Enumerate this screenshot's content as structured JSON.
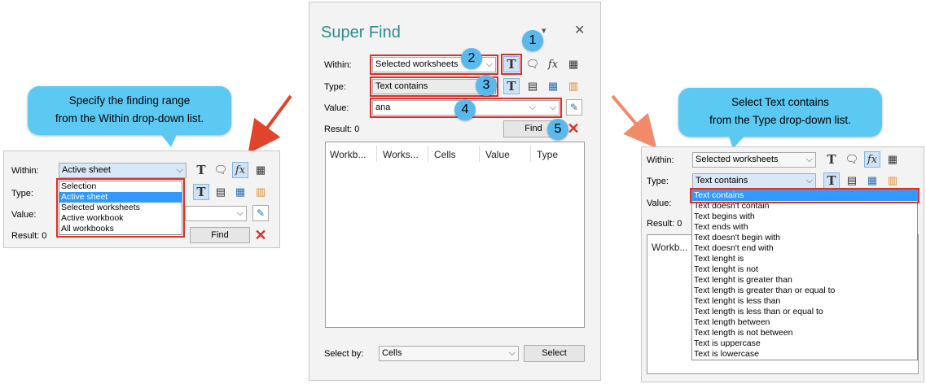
{
  "left": {
    "callout": [
      "Specify the finding range",
      "from the Within drop-down list."
    ],
    "within_label": "Within:",
    "within_value": "Active sheet",
    "type_label": "Type:",
    "value_label": "Value:",
    "result_label": "Result: 0",
    "find_label": "Find",
    "options": [
      "Selection",
      "Active sheet",
      "Selected worksheets",
      "Active workbook",
      "All workbooks"
    ]
  },
  "center": {
    "title": "Super Find",
    "within_label": "Within:",
    "within_value": "Selected worksheets",
    "type_label": "Type:",
    "type_value": "Text contains",
    "value_label": "Value:",
    "value_value": "ana",
    "result_label": "Result: 0",
    "find_label": "Find",
    "columns": [
      "Workb...",
      "Works...",
      "Cells",
      "Value",
      "Type"
    ],
    "select_by_label": "Select by:",
    "select_by_value": "Cells",
    "select_label": "Select",
    "badges": [
      "1",
      "2",
      "3",
      "4",
      "5"
    ]
  },
  "right": {
    "callout": [
      "Select Text contains",
      "from the Type drop-down list."
    ],
    "within_label": "Within:",
    "within_value": "Selected worksheets",
    "type_label": "Type:",
    "type_value": "Text contains",
    "value_label": "Value:",
    "result_label": "Result: 0",
    "column_first": "Workb...",
    "options": [
      "Text contains",
      "Text doesn't contain",
      "Text begins with",
      "Text ends with",
      "Text doesn't begin with",
      "Text doesn't end with",
      "Text lenght is",
      "Text lenght is not",
      "Text lenght is greater than",
      "Text length is greater than or equal to",
      "Text lenght is less than",
      "Text length is less than or equal to",
      "Text length between",
      "Text length is not between",
      "Text is uppercase",
      "Text is lowercase"
    ]
  },
  "colors": {
    "accent_red": "#d9302a",
    "callout_blue": "#5cc9f3",
    "badge_blue": "#5ab9ec",
    "title_teal": "#2e8b8b",
    "highlight": "#3399ff"
  },
  "icons": [
    "text-T-icon",
    "comment-icon",
    "formula-fx-icon",
    "table-icon",
    "calculator-icon",
    "calendar-icon",
    "grid-icon",
    "eyedropper-icon",
    "close-x-icon",
    "minimize-icon"
  ]
}
